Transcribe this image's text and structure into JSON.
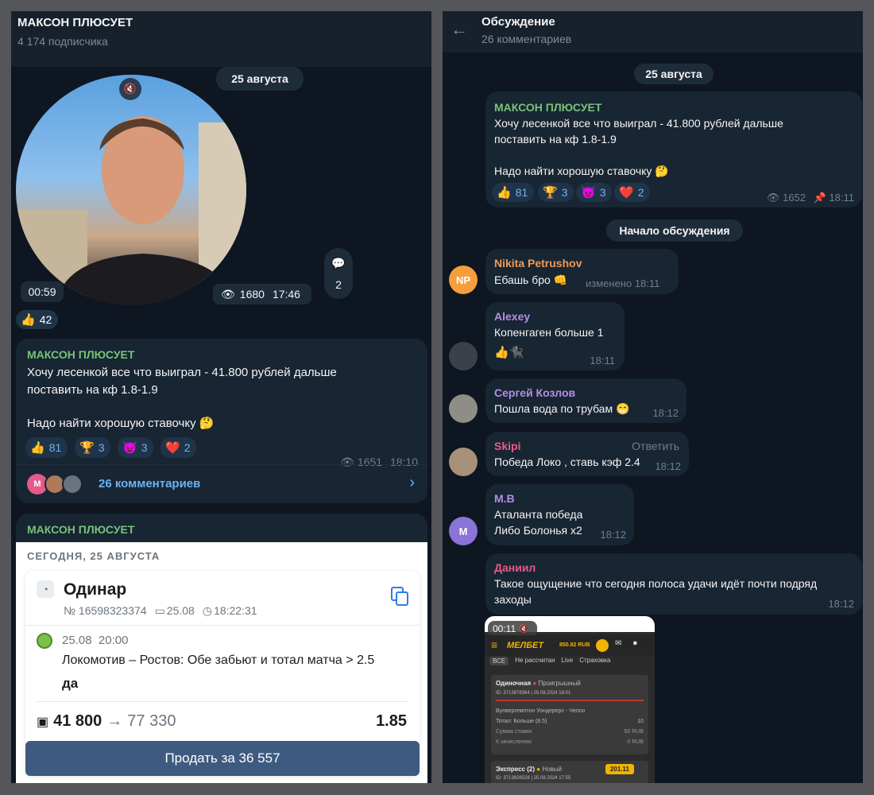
{
  "left": {
    "channel_title": "МАКСОН ПЛЮСУЕТ",
    "subscribers": "4 174 подписчика",
    "date_pill": "25 августа",
    "video": {
      "duration": "00:59",
      "views": "1680",
      "time": "17:46",
      "comments_count": "2",
      "reaction_count": "42"
    },
    "post": {
      "sender": "МАКСОН ПЛЮСУЕТ",
      "line1": "Хочу лесенкой все что выиграл - 41.800 рублей дальше",
      "line2": "поставить на кф 1.8-1.9",
      "line3": "Надо найти хорошую ставочку 🤔",
      "reactions": [
        {
          "emoji": "👍",
          "count": "81"
        },
        {
          "emoji": "🏆",
          "count": "3"
        },
        {
          "emoji": "😈",
          "count": "3"
        },
        {
          "emoji": "❤️",
          "count": "2"
        }
      ],
      "views": "1651",
      "time": "18:10",
      "comments_label": "26 комментариев",
      "commenter_initial": "M"
    },
    "post2": {
      "sender": "МАКСОН ПЛЮСУЕТ",
      "bet_date_label": "СЕГОДНЯ, 25 АВГУСТА",
      "bet_type": "Одинар",
      "bet_number": "№ 16598323374",
      "bet_date": "25.08",
      "bet_time": "18:22:31",
      "event_date": "25.08",
      "event_time": "20:00",
      "event_name": "Локомотив – Ростов: Обе забьют и тотал матча > 2.5",
      "outcome": "да",
      "stake": "41 800",
      "arrow": "→",
      "payout": "77 330",
      "odds": "1.85",
      "sell_button": "Продать за 36 557"
    }
  },
  "right": {
    "title": "Обсуждение",
    "subtitle": "26 комментариев",
    "date_pill": "25 августа",
    "post": {
      "sender": "МАКСОН ПЛЮСУЕТ",
      "line1": "Хочу лесенкой все что выиграл - 41.800 рублей дальше",
      "line2": "поставить на кф 1.8-1.9",
      "line3": "Надо найти хорошую ставочку 🤔",
      "reactions": [
        {
          "emoji": "👍",
          "count": "81"
        },
        {
          "emoji": "🏆",
          "count": "3"
        },
        {
          "emoji": "😈",
          "count": "3"
        },
        {
          "emoji": "❤️",
          "count": "2"
        }
      ],
      "views": "1652",
      "time": "18:11"
    },
    "discussion_pill": "Начало обсуждения",
    "comments": [
      {
        "avatar": "NP",
        "author": "Nikita Petrushov",
        "text": "Ебашь бро 👊",
        "meta": "изменено 18:11"
      },
      {
        "author": "Alexey",
        "text": "Копенгаген больше 1",
        "reactions": "👍🐈‍⬛",
        "meta": "18:11"
      },
      {
        "author": "Сергей Козлов",
        "text": "Пошла вода по трубам 😁",
        "meta": "18:12"
      },
      {
        "author": "Skipi",
        "reply": "Ответить",
        "text": "Победа Локо , ставь кэф 2.4",
        "meta": "18:12"
      },
      {
        "avatar": "M",
        "author": "M.B",
        "text1": "Аталанта победа",
        "text2": "Либо Болонья х2",
        "meta": "18:12"
      },
      {
        "author": "Даниил",
        "text1": "Такое ощущение что сегодня полоса удачи идёт почти подряд",
        "text2": "заходы",
        "meta": "18:12"
      }
    ],
    "video_note": {
      "duration": "00:11",
      "brand": "МЕЛБЕТ",
      "balance": "850.82 RUB",
      "tabs": [
        "ВСЕ",
        "Не рассчитан",
        "Live",
        "Страховка"
      ],
      "bet1_title": "Одиночная",
      "bet1_status": "Проигрышный",
      "bet1_id": "ID: 3713878364 | 25.08.2024 18:01",
      "bet1_match": "Вулвергемптон Уондерерс - Челси",
      "bet1_total_label": "Тотал: Больше (8.5)",
      "bet1_total_odds": "10",
      "bet1_sum_label": "Сумма ставки",
      "bet1_sum": "50 RUB",
      "bet1_credit_label": "К зачислению",
      "bet1_credit": "0 RUB",
      "bet2_title": "Экспресс (2)",
      "bet2_status": "Новый",
      "bet2_id": "ID: 3713826528 | 25.08.2024 17:55",
      "bet2_amount": "201.11"
    }
  }
}
